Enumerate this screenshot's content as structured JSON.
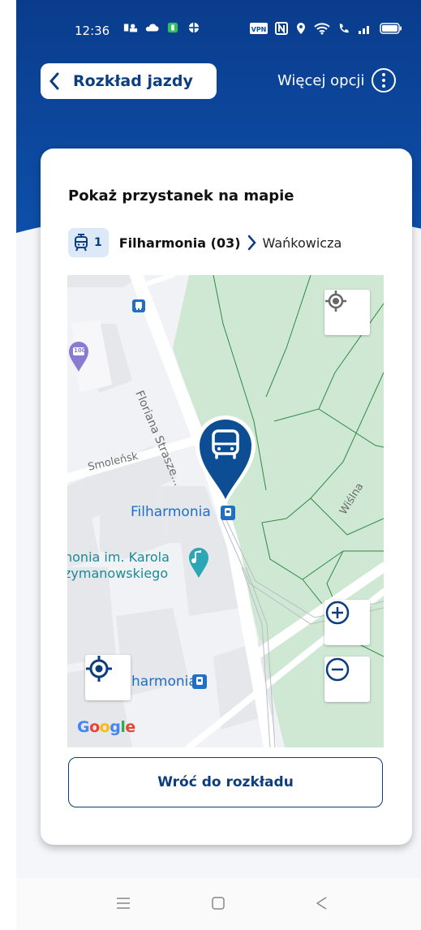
{
  "status_bar": {
    "time": "12:36"
  },
  "header": {
    "back_label": "Rozkład jazdy",
    "more_label": "Więcej opcji"
  },
  "card": {
    "title": "Pokaż przystanek na mapie",
    "line_number": "1",
    "stop_from": "Filharmonia (03)",
    "stop_to": "Wańkowicza"
  },
  "map": {
    "street_floriana": "Floriana Strasze...",
    "street_smolensk": "Smoleńsk",
    "street_wislna": "Wiślna",
    "poi_filharmonia": "Filharmonia",
    "poi_karol_line1": "nonia im. Karola",
    "poi_karol_line2": "zymanowskiego",
    "poi_bottom": "harmonia",
    "badge_100": "100",
    "google_letters": [
      "G",
      "o",
      "o",
      "g",
      "l",
      "e"
    ]
  },
  "actions": {
    "back_to_timetable": "Wróć do rozkładu"
  },
  "colors": {
    "brand_blue": "#0c3d7e",
    "header_blue": "#0d4da6",
    "park_green": "#cfe8d4",
    "map_blue": "#1f6fc6",
    "badge_bg": "#dbe9f9"
  },
  "icons": {
    "back": "chevron-left-icon",
    "more": "more-vertical-icon",
    "tram": "tram-icon",
    "location": "my-location-icon",
    "zoom_in": "zoom-in-icon",
    "zoom_out": "zoom-out-icon",
    "stop_pin": "bus-stop-pin-icon"
  }
}
